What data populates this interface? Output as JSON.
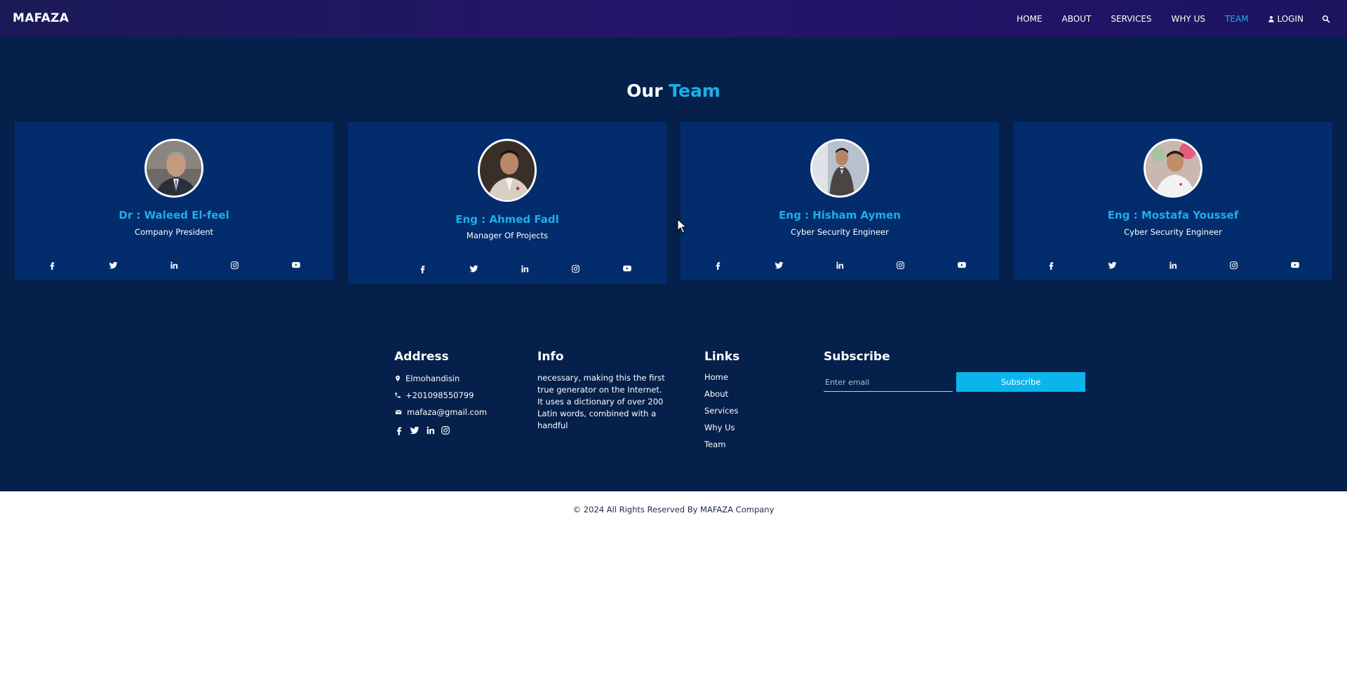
{
  "brand": "MAFAZA",
  "nav": {
    "items": [
      "HOME",
      "ABOUT",
      "SERVICES",
      "WHY US",
      "TEAM"
    ],
    "active": "TEAM",
    "login": "LOGIN"
  },
  "team": {
    "heading_part1": "Our",
    "heading_part2": "Team",
    "members": [
      {
        "name": "Dr : Waleed El-feel",
        "role": "Company President"
      },
      {
        "name": "Eng : Ahmed Fadl",
        "role": "Manager Of Projects"
      },
      {
        "name": "Eng : Hisham Aymen",
        "role": "Cyber Security Engineer"
      },
      {
        "name": "Eng : Mostafa Youssef",
        "role": "Cyber Security Engineer"
      }
    ],
    "social_icons": [
      "facebook-icon",
      "twitter-icon",
      "linkedin-icon",
      "instagram-icon",
      "youtube-icon"
    ]
  },
  "footer": {
    "address": {
      "title": "Address",
      "location": "Elmohandisin",
      "phone": "+201098550799",
      "email": "mafaza@gmail.com"
    },
    "info": {
      "title": "Info",
      "text": "necessary, making this the first true generator on the Internet. It uses a dictionary of over 200 Latin words, combined with a handful"
    },
    "links": {
      "title": "Links",
      "items": [
        "Home",
        "About",
        "Services",
        "Why Us",
        "Team"
      ]
    },
    "subscribe": {
      "title": "Subscribe",
      "placeholder": "Enter email",
      "button": "Subscribe"
    },
    "copyright": "© 2024 All Rights Reserved By MAFAZA Company"
  },
  "colors": {
    "accent": "#1ab0e8",
    "section_bg": "#05204a",
    "card_bg": "#032c6c",
    "subscribe_button": "#0ab5ec"
  }
}
